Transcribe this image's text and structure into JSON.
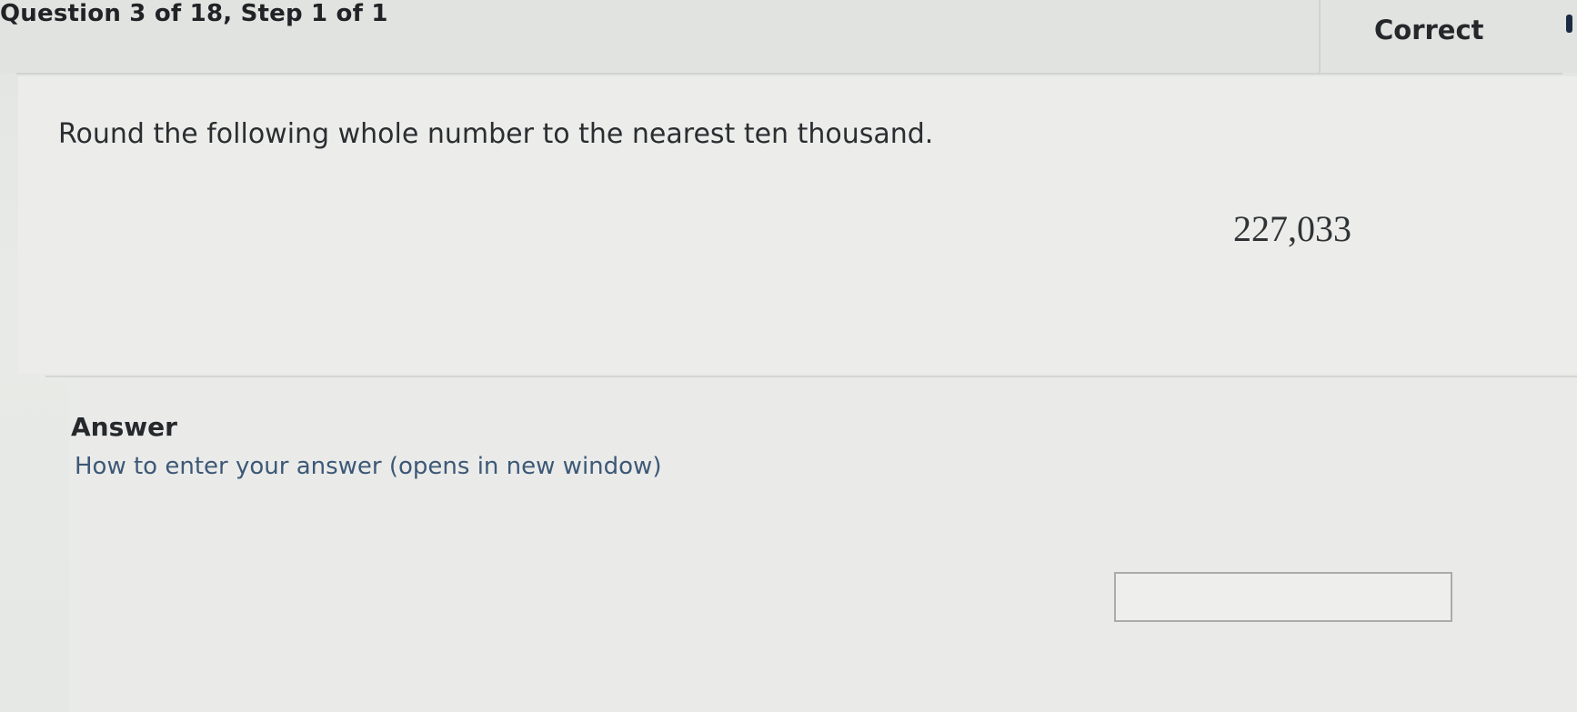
{
  "header": {
    "question_progress": "Question 3 of 18, Step 1 of 1",
    "status": "Correct"
  },
  "question": {
    "prompt": "Round the following whole number to the nearest ten thousand.",
    "number": "227,033"
  },
  "answer": {
    "heading": "Answer",
    "help_link": "How to enter your answer (opens in new window)",
    "input_value": ""
  }
}
